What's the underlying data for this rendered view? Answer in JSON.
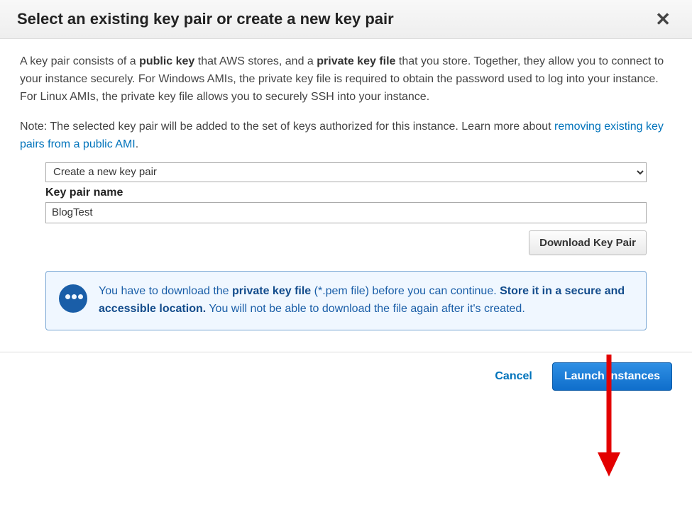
{
  "header": {
    "title": "Select an existing key pair or create a new key pair"
  },
  "desc": {
    "p1a": "A key pair consists of a ",
    "p1b": "public key",
    "p1c": " that AWS stores, and a ",
    "p1d": "private key file",
    "p1e": " that you store. Together, they allow you to connect to your instance securely. For Windows AMIs, the private key file is required to obtain the password used to log into your instance. For Linux AMIs, the private key file allows you to securely SSH into your instance.",
    "note1": "Note: The selected key pair will be added to the set of keys authorized for this instance. Learn more about ",
    "note_link": "removing existing key pairs from a public AMI",
    "period": "."
  },
  "form": {
    "select_value": "Create a new key pair",
    "keypair_label": "Key pair name",
    "keypair_value": "BlogTest",
    "download_label": "Download Key Pair"
  },
  "alert": {
    "a1": "You have to download the ",
    "a2": "private key file",
    "a3": " (*.pem file) before you can continue. ",
    "a4": "Store it in a secure and accessible location.",
    "a5": " You will not be able to download the file again after it's created."
  },
  "footer": {
    "cancel": "Cancel",
    "launch": "Launch Instances"
  }
}
